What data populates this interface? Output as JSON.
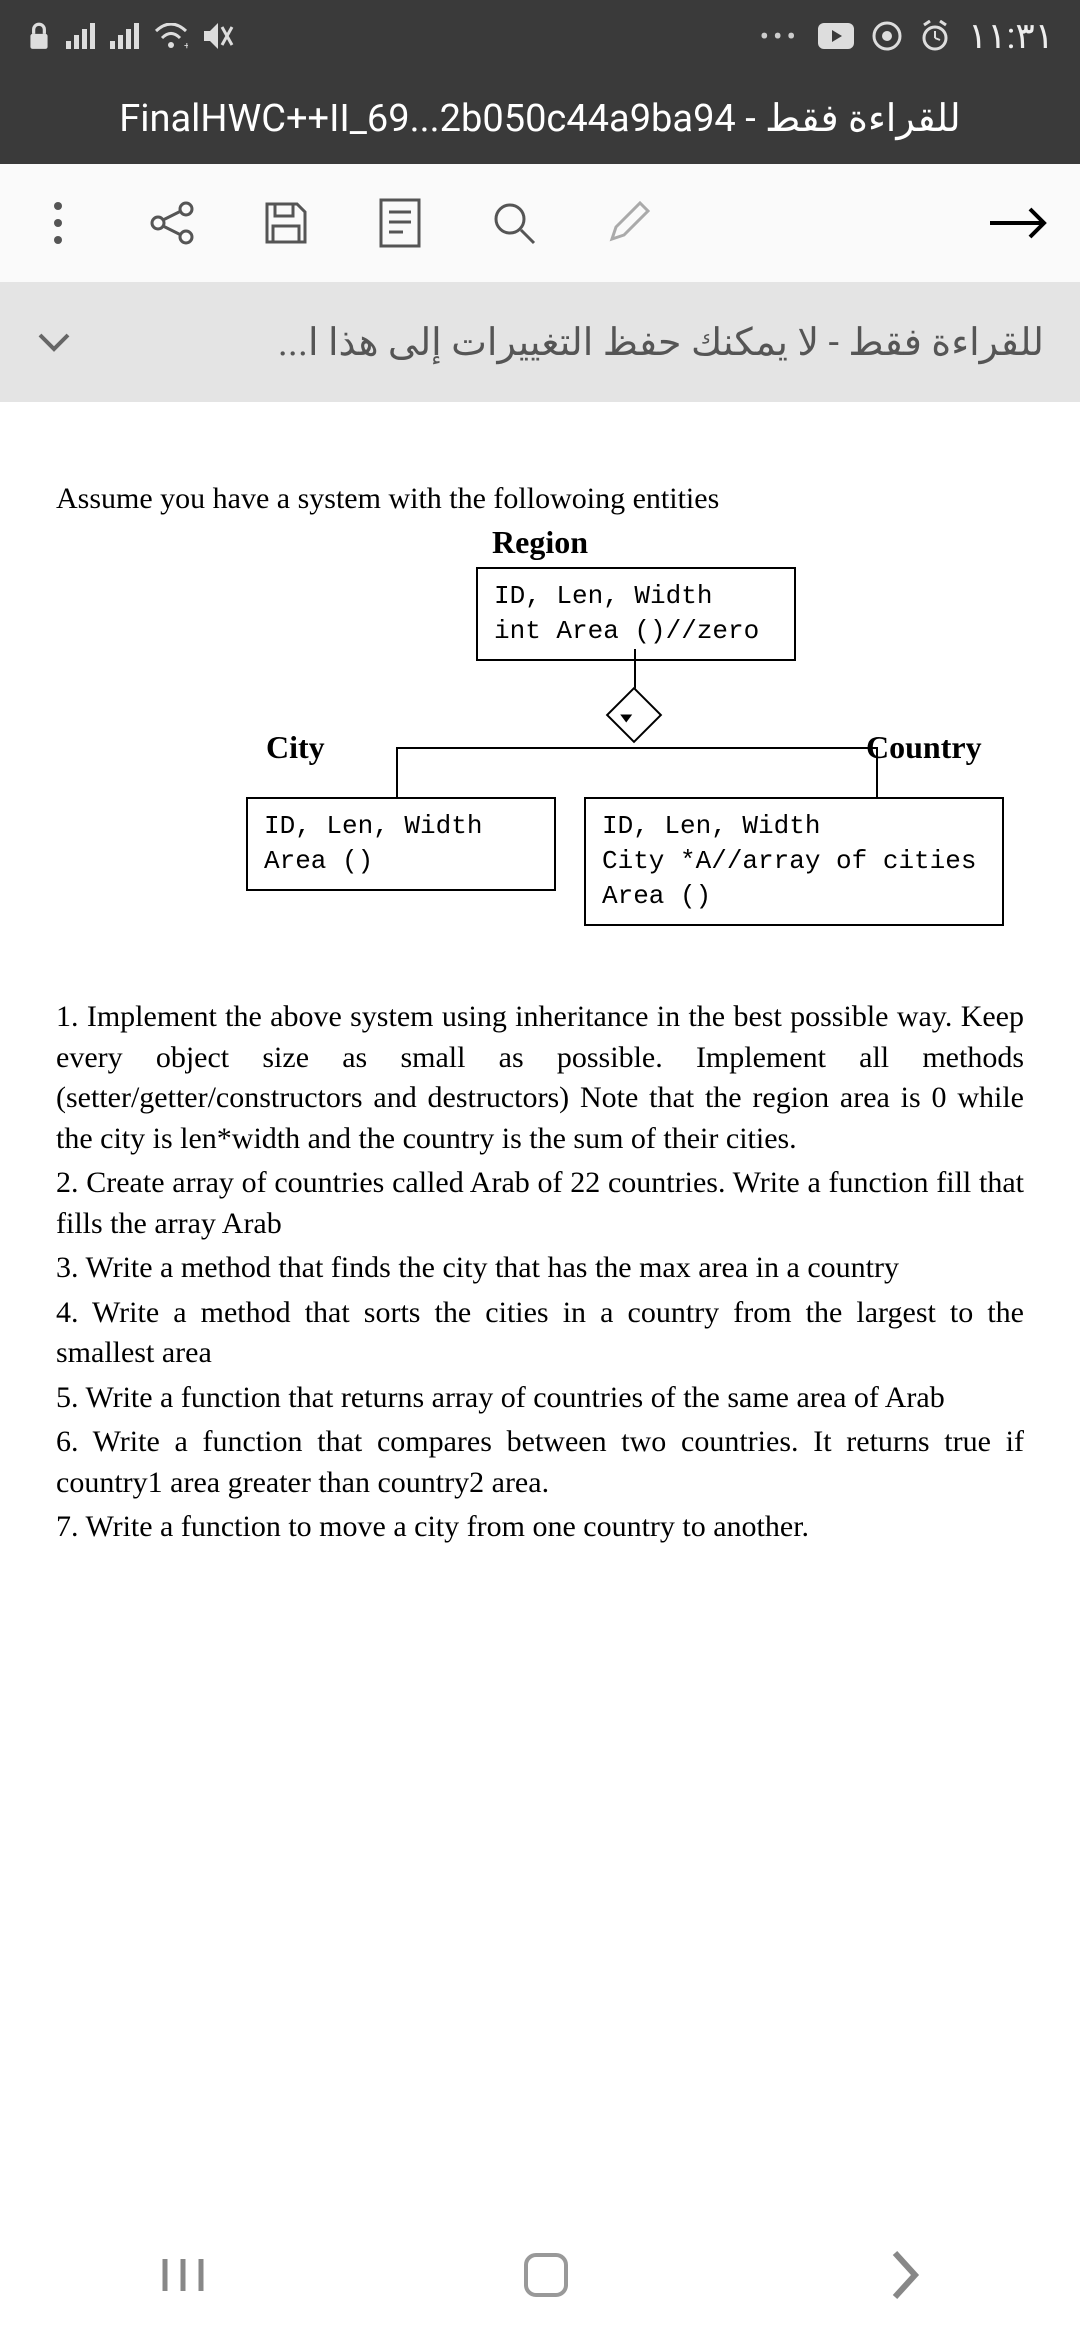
{
  "status": {
    "clock": "١١:٣١"
  },
  "title": "للقراءة فقط - FinalHWC++II_69...2b050c44a9ba94",
  "banner": "للقراءة فقط - لا يمكنك حفظ التغييرات إلى هذا ا...",
  "doc": {
    "intro": "Assume you have a system with the followoing entities",
    "region_title": "Region",
    "box_region": "ID, Len, Width\nint Area ()//zero",
    "label_city": "City",
    "label_country": "Country",
    "box_city": "ID, Len, Width\nArea ()",
    "box_country": "ID, Len, Width\nCity *A//array of cities\nArea ()",
    "questions": [
      "1. Implement the above system using inheritance in the best possible way. Keep every object size as small as possible. Implement all methods (setter/getter/constructors and destructors) Note that the region area is 0 while the city is len*width and the country is the sum of their cities.",
      "2. Create array of countries called Arab of 22 countries. Write a function fill that fills the array Arab",
      "3.  Write a method that finds the city that has the max area in a country",
      "4. Write a method that sorts the cities in a country from the largest to the smallest area",
      "5. Write a function that returns array of countries of the same area of Arab",
      "6. Write a function that compares between two countries. It returns true if country1 area greater than country2 area.",
      "7. Write a function to move a city from one country to another."
    ]
  }
}
